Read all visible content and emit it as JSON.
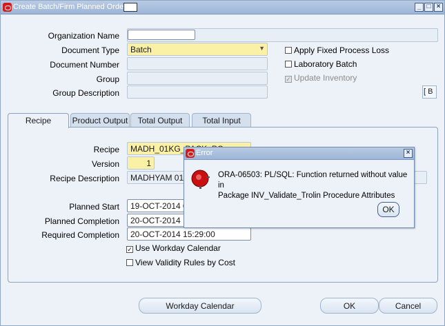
{
  "window": {
    "title": "Create Batch/Firm Planned Order",
    "controls": [
      "_",
      "□",
      "×"
    ]
  },
  "header": {
    "organization_name_label": "Organization Name",
    "organization_name_value": "",
    "document_type_label": "Document Type",
    "document_type_value": "Batch",
    "document_number_label": "Document Number",
    "document_number_value": "",
    "group_label": "Group",
    "group_value": "",
    "group_description_label": "Group Description",
    "group_description_value": "",
    "apply_fixed_process_loss_label": "Apply Fixed Process Loss",
    "laboratory_batch_label": "Laboratory Batch",
    "update_inventory_label": "Update Inventory",
    "bracket_button_label": "[ B"
  },
  "tabs": [
    {
      "label": "Recipe",
      "active": true
    },
    {
      "label": "Product Output",
      "active": false
    },
    {
      "label": "Total Output",
      "active": false
    },
    {
      "label": "Total Input",
      "active": false
    }
  ],
  "recipe": {
    "recipe_label": "Recipe",
    "recipe_value": "MADH_01KG_PACK_PC",
    "version_label": "Version",
    "version_value": "1",
    "description_label": "Recipe Description",
    "description_value": "MADHYAM 01 KG",
    "planned_start_label": "Planned Start",
    "planned_start_value": "19-OCT-2014 08",
    "planned_completion_label": "Planned Completion",
    "planned_completion_value": "20-OCT-2014 15",
    "required_completion_label": "Required Completion",
    "required_completion_value": "20-OCT-2014 15:29:00",
    "use_workday_calendar_label": "Use Workday Calendar",
    "view_validity_rules_label": "View Validity Rules by Cost"
  },
  "buttons": {
    "workday_calendar": "Workday Calendar",
    "ok": "OK",
    "cancel": "Cancel"
  },
  "error_dialog": {
    "title": "Error",
    "message_line1": "ORA-06503: PL/SQL: Function returned without value in",
    "message_line2": "Package INV_Validate_Trolin Procedure Attributes",
    "ok_label": "OK"
  }
}
